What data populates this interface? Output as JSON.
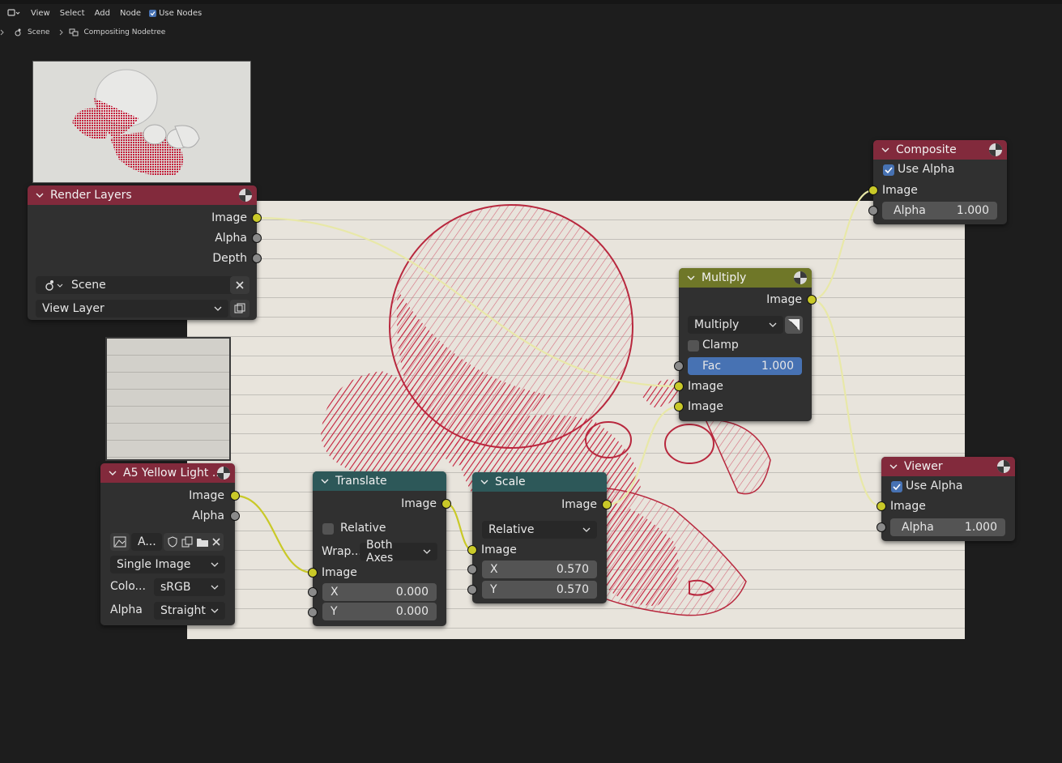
{
  "header": {
    "menus": [
      "View",
      "Select",
      "Add",
      "Node"
    ],
    "use_nodes_label": "Use Nodes",
    "use_nodes_checked": true
  },
  "breadcrumb": {
    "scene": "Scene",
    "tree": "Compositing Nodetree"
  },
  "nodes": {
    "render_layers": {
      "title": "Render Layers",
      "outputs": [
        "Image",
        "Alpha",
        "Depth"
      ],
      "scene": "Scene",
      "layer": "View Layer"
    },
    "image": {
      "title": "A5 Yellow Light ...",
      "outputs": [
        "Image",
        "Alpha"
      ],
      "image_name": "A...",
      "source": "Single Image",
      "color_label": "Colo...",
      "color_value": "sRGB",
      "alpha_label": "Alpha",
      "alpha_value": "Straight"
    },
    "translate": {
      "title": "Translate",
      "output": "Image",
      "relative_label": "Relative",
      "relative_checked": false,
      "wrap_label": "Wrap...",
      "wrap_value": "Both Axes",
      "input": "Image",
      "x_label": "X",
      "x_value": "0.000",
      "y_label": "Y",
      "y_value": "0.000"
    },
    "scale": {
      "title": "Scale",
      "output": "Image",
      "mode": "Relative",
      "input": "Image",
      "x_label": "X",
      "x_value": "0.570",
      "y_label": "Y",
      "y_value": "0.570"
    },
    "multiply": {
      "title": "Multiply",
      "output": "Image",
      "blend_mode": "Multiply",
      "clamp_label": "Clamp",
      "clamp_checked": false,
      "fac_label": "Fac",
      "fac_value": "1.000",
      "input_a": "Image",
      "input_b": "Image"
    },
    "composite": {
      "title": "Composite",
      "use_alpha_label": "Use Alpha",
      "use_alpha_checked": true,
      "input": "Image",
      "alpha_label": "Alpha",
      "alpha_value": "1.000"
    },
    "viewer": {
      "title": "Viewer",
      "use_alpha_label": "Use Alpha",
      "use_alpha_checked": true,
      "input": "Image",
      "alpha_label": "Alpha",
      "alpha_value": "1.000"
    }
  },
  "colors": {
    "header_input": "#822a3c",
    "header_color": "#6f7728",
    "header_distort": "#2d5859",
    "socket_color": "#c9c928",
    "socket_value": "#8a8a8a",
    "accent": "#4772b3",
    "link": "#e8e8a8",
    "sketch_red": "#c41e3a"
  }
}
